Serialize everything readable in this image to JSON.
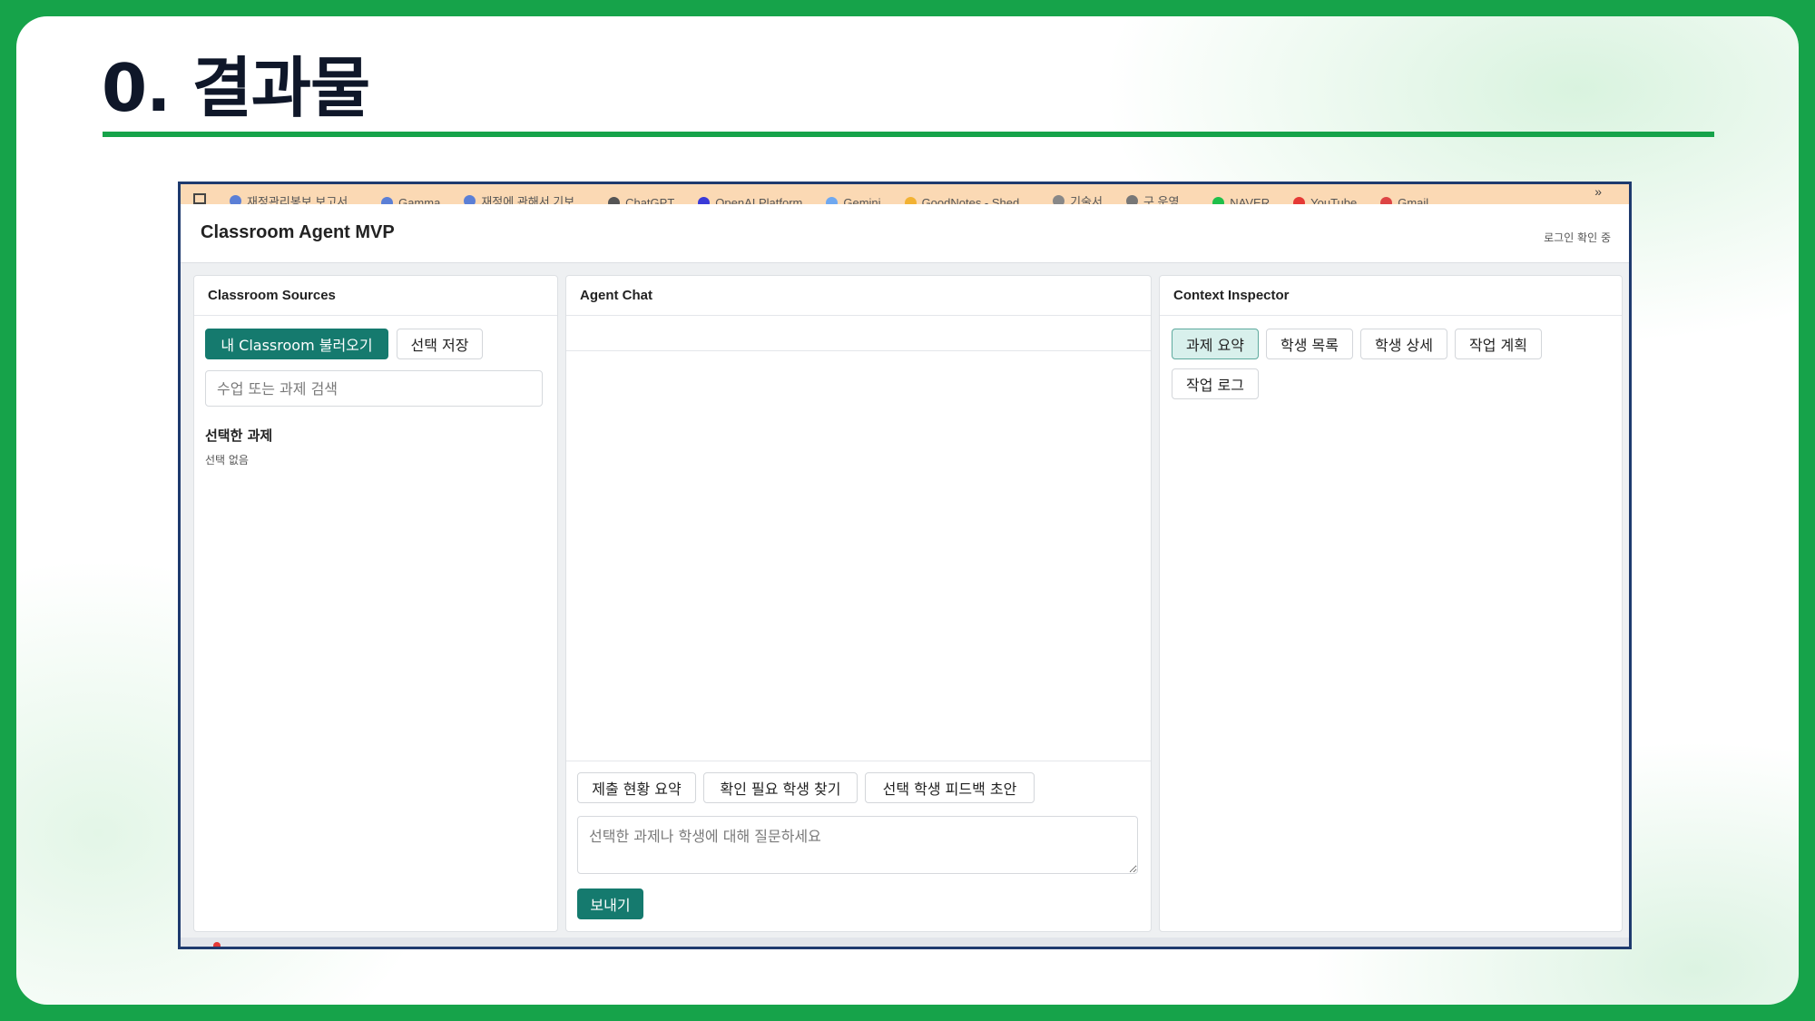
{
  "slide": {
    "title": "0. 결과물",
    "accent_color": "#16a34a"
  },
  "bookmarks": {
    "items": [
      "재정관리봉보 보고서...",
      "Gamma",
      "재정에 관해서 기보...",
      "ChatGPT",
      "OpenAI Platform",
      "Gemini",
      "GoodNotes - Shed...",
      "기술서",
      "구 운영...",
      "NAVER",
      "YouTube",
      "Gmail"
    ],
    "more": "»"
  },
  "app": {
    "title": "Classroom Agent MVP",
    "login_status": "로그인 확인 중",
    "primary_color": "#157a6e"
  },
  "sources": {
    "heading": "Classroom Sources",
    "load_button": "내 Classroom 불러오기",
    "save_button": "선택 저장",
    "search_placeholder": "수업 또는 과제 검색",
    "selected_label": "선택한 과제",
    "selected_value": "선택 없음"
  },
  "chat": {
    "heading": "Agent Chat",
    "quick_actions": [
      "제출 현황 요약",
      "확인 필요 학생 찾기",
      "선택 학생 피드백 초안"
    ],
    "input_placeholder": "선택한 과제나 학생에 대해 질문하세요",
    "send_button": "보내기"
  },
  "inspector": {
    "heading": "Context Inspector",
    "tabs": [
      "과제 요약",
      "학생 목록",
      "학생 상세",
      "작업 계획",
      "작업 로그"
    ],
    "active_tab": "과제 요약"
  }
}
